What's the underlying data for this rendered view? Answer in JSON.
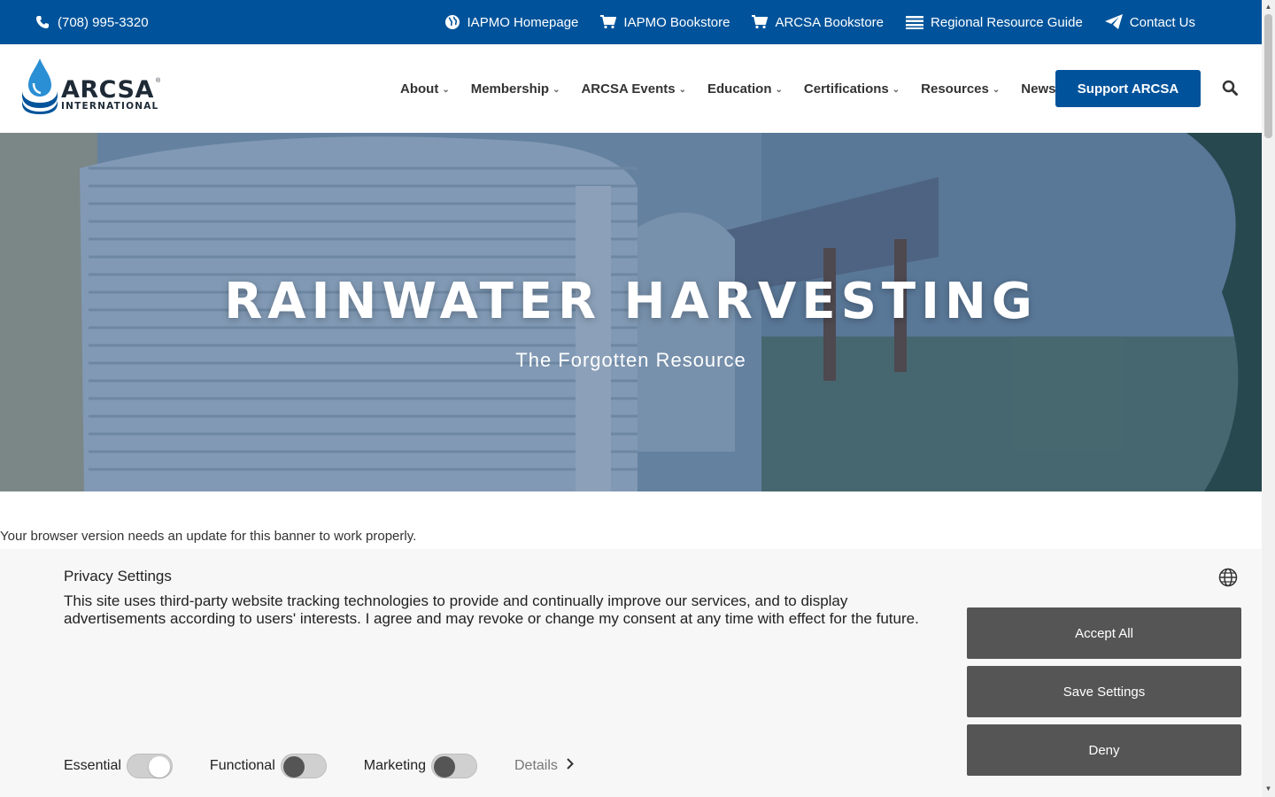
{
  "topbar": {
    "phone": "(708) 995-3320",
    "links": [
      {
        "label": "IAPMO Homepage",
        "icon": "globe-icon"
      },
      {
        "label": "IAPMO Bookstore",
        "icon": "cart-icon"
      },
      {
        "label": "ARCSA Bookstore",
        "icon": "cart-icon"
      },
      {
        "label": "Regional Resource Guide",
        "icon": "list-icon"
      },
      {
        "label": "Contact Us",
        "icon": "paper-plane-icon"
      }
    ]
  },
  "logo": {
    "wordmark": "ARCSA",
    "sub": "INTERNATIONAL",
    "reg": "®"
  },
  "nav": {
    "items": [
      "About",
      "Membership",
      "ARCSA Events",
      "Education",
      "Certifications",
      "Resources",
      "News"
    ],
    "chevron": "⌄",
    "support_label": "Support ARCSA"
  },
  "hero": {
    "title": "RAINWATER HARVESTING",
    "tagline": "The Forgotten Resource"
  },
  "cookie": {
    "notice": "Your browser version needs an update for this banner to work properly.",
    "title": "Privacy Settings",
    "description": "This site uses third-party website tracking technologies to provide and continually improve our services, and to display advertisements according to users' interests. I agree and may revoke or change my consent at any time with effect for the future.",
    "buttons": {
      "accept": "Accept All",
      "save": "Save Settings",
      "deny": "Deny"
    },
    "toggles": [
      {
        "label": "Essential",
        "on": true
      },
      {
        "label": "Functional",
        "on": false
      },
      {
        "label": "Marketing",
        "on": false
      }
    ],
    "details_label": "Details"
  },
  "colors": {
    "brand_blue": "#00539b",
    "button_gray": "#555555",
    "banner_bg": "#f7f7f7"
  }
}
